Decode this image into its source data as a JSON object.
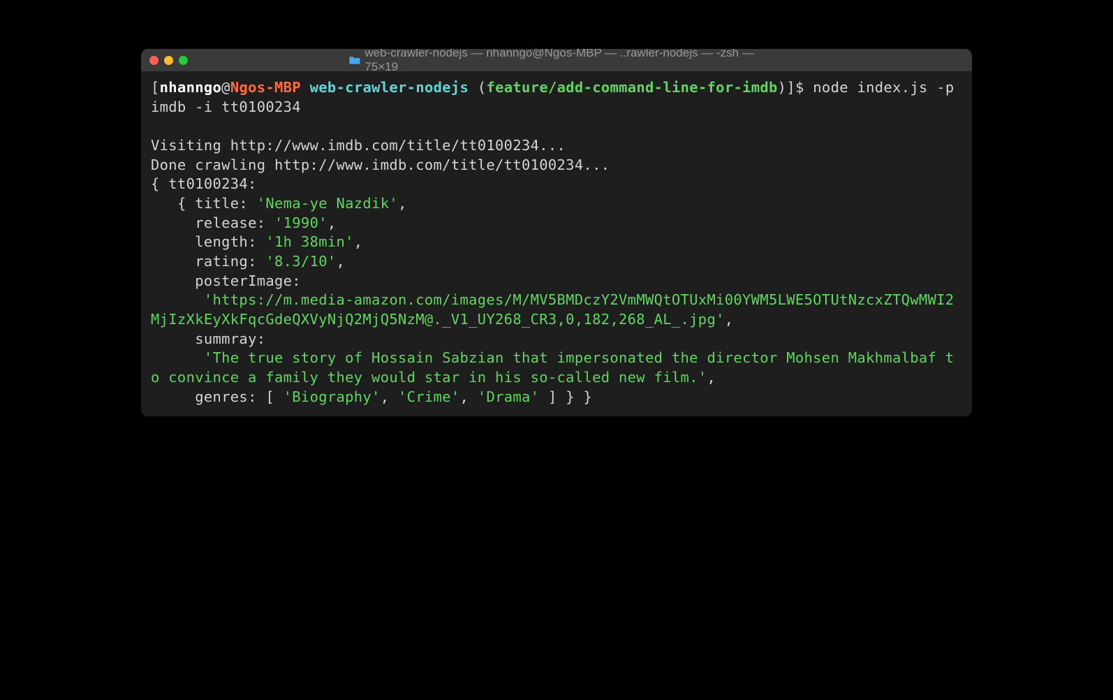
{
  "window": {
    "title": "web-crawler-nodejs — nhanngo@Ngos-MBP — ..rawler-nodejs — -zsh — 75×19"
  },
  "prompt": {
    "bracket_open": "[",
    "user": "nhanngo",
    "at": "@",
    "host": "Ngos-MBP",
    "space1": " ",
    "dir": "web-crawler-nodejs",
    "space2": " ",
    "paren_open": "(",
    "branch": "feature/add-command-line-for-imdb",
    "paren_close": ")",
    "bracket_close": "]",
    "dollar": "$ "
  },
  "command": "node index.js -p imdb -i tt0100234",
  "output": {
    "line1": "Visiting http://www.imdb.com/title/tt0100234...",
    "line2": "Done crawling http://www.imdb.com/title/tt0100234...",
    "obj_open": "{ tt0100234:",
    "obj_inner_open": "   { title: ",
    "title_val": "'Nema-ye Nazdik'",
    "comma1": ",",
    "release_key": "     release: ",
    "release_val": "'1990'",
    "comma2": ",",
    "length_key": "     length: ",
    "length_val": "'1h 38min'",
    "comma3": ",",
    "rating_key": "     rating: ",
    "rating_val": "'8.3/10'",
    "comma4": ",",
    "poster_key": "     posterImage:",
    "poster_indent": "      ",
    "poster_val": "'https://m.media-amazon.com/images/M/MV5BMDczY2VmMWQtOTUxMi00YWM5LWE5OTUtNzcxZTQwMWI2MjIzXkEyXkFqcGdeQXVyNjQ2MjQ5NzM@._V1_UY268_CR3,0,182,268_AL_.jpg'",
    "comma5": ",",
    "summary_key": "     summray:",
    "summary_indent": "      ",
    "summary_val": "'The true story of Hossain Sabzian that impersonated the director Mohsen Makhmalbaf to convince a family they would star in his so-called new film.'",
    "comma6": ",",
    "genres_key": "     genres: [ ",
    "genres_v1": "'Biography'",
    "genres_s1": ", ",
    "genres_v2": "'Crime'",
    "genres_s2": ", ",
    "genres_v3": "'Drama'",
    "genres_close": " ] } }"
  }
}
